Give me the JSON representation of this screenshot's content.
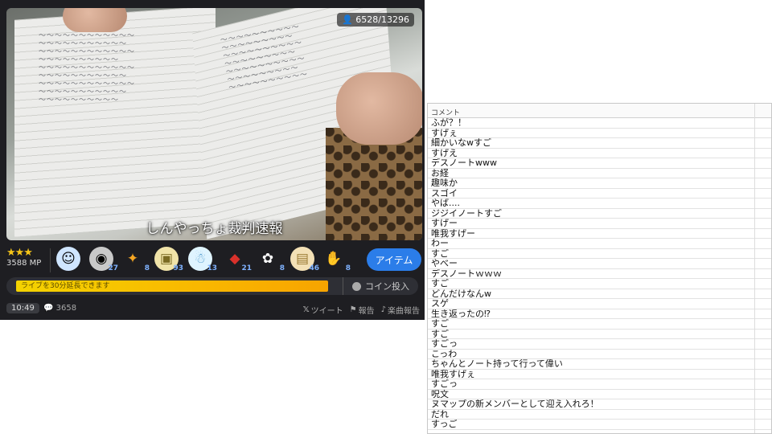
{
  "video": {
    "viewers": "6528/13296",
    "caption": "しんやっちょ裁判速報"
  },
  "rank": {
    "stars": "★★★",
    "mp": "3588 MP"
  },
  "gifts": [
    {
      "icon": "face-gift-icon",
      "glyph": "☺",
      "count": ""
    },
    {
      "icon": "stone-gift-icon",
      "glyph": "◉",
      "count": "27"
    },
    {
      "icon": "party-gift-icon",
      "glyph": "✦",
      "count": "8"
    },
    {
      "icon": "scroll-gift-icon",
      "glyph": "▣",
      "count": "93"
    },
    {
      "icon": "ghost-gift-icon",
      "glyph": "☃",
      "count": "13"
    },
    {
      "icon": "santa-gift-icon",
      "glyph": "◆",
      "count": "21"
    },
    {
      "icon": "character-gift-icon",
      "glyph": "✿",
      "count": "8"
    },
    {
      "icon": "paper-gift-icon",
      "glyph": "▤",
      "count": "46"
    },
    {
      "icon": "clap-gift-icon",
      "glyph": "✋",
      "count": "8"
    }
  ],
  "item_button": "アイテム",
  "extend_label": "ライブを30分延長できます",
  "coin_label": "コイン投入",
  "footer": {
    "time": "10:49",
    "comment_count": "3658",
    "tweet": "ツイート",
    "report": "報告",
    "music_report": "楽曲報告"
  },
  "comments_header": "コメント",
  "comments": [
    "ふが？！",
    "すげぇ",
    "細かいなwすご",
    "すげえ",
    "デスノートwww",
    "お経",
    "趣味か",
    "スゴイ",
    "やば....",
    "ジジイノートすご",
    "すげー",
    "唯我すげー",
    "わー",
    "すご",
    "やべー",
    "デスノートｗｗｗ",
    "すご",
    "どんだけなんw",
    "スゲ",
    "生き返ったの⁉",
    "すご",
    "すご",
    "すごっ",
    "こっわ",
    "ちゃんとノート持って行って偉い",
    "唯我すげぇ",
    "すごっ",
    "呪文",
    "ヌマップの新メンバーとして迎え入れろ！",
    "だれ",
    "すっご"
  ]
}
